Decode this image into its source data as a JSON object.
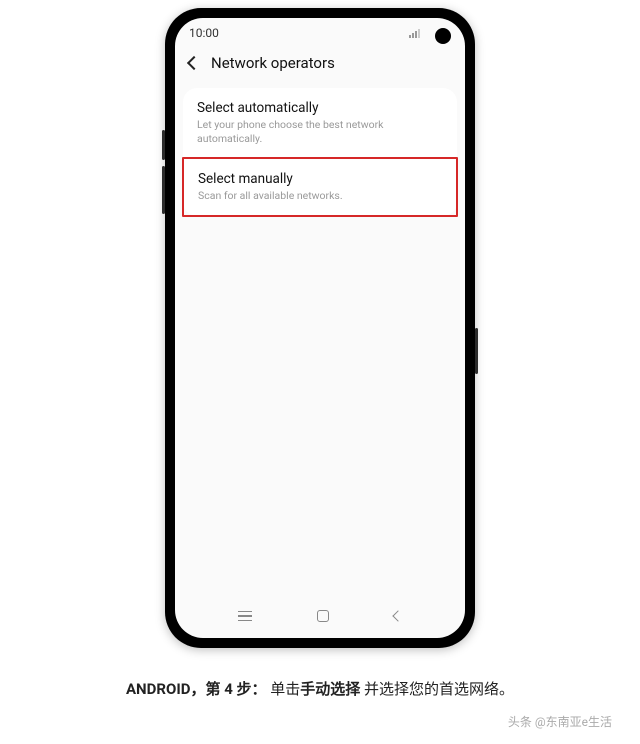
{
  "status": {
    "time": "10:00"
  },
  "header": {
    "title": "Network operators"
  },
  "settings": {
    "auto": {
      "title": "Select automatically",
      "subtitle": "Let your phone choose the best network automatically."
    },
    "manual": {
      "title": "Select manually",
      "subtitle": "Scan for all available networks."
    }
  },
  "caption": {
    "prefix": "ANDROID，第 4 步：",
    "action1": "单击",
    "bold": "手动选择",
    "action2": " 并选择您的首选网络。"
  },
  "watermark": "头条 @东南亚e生活"
}
